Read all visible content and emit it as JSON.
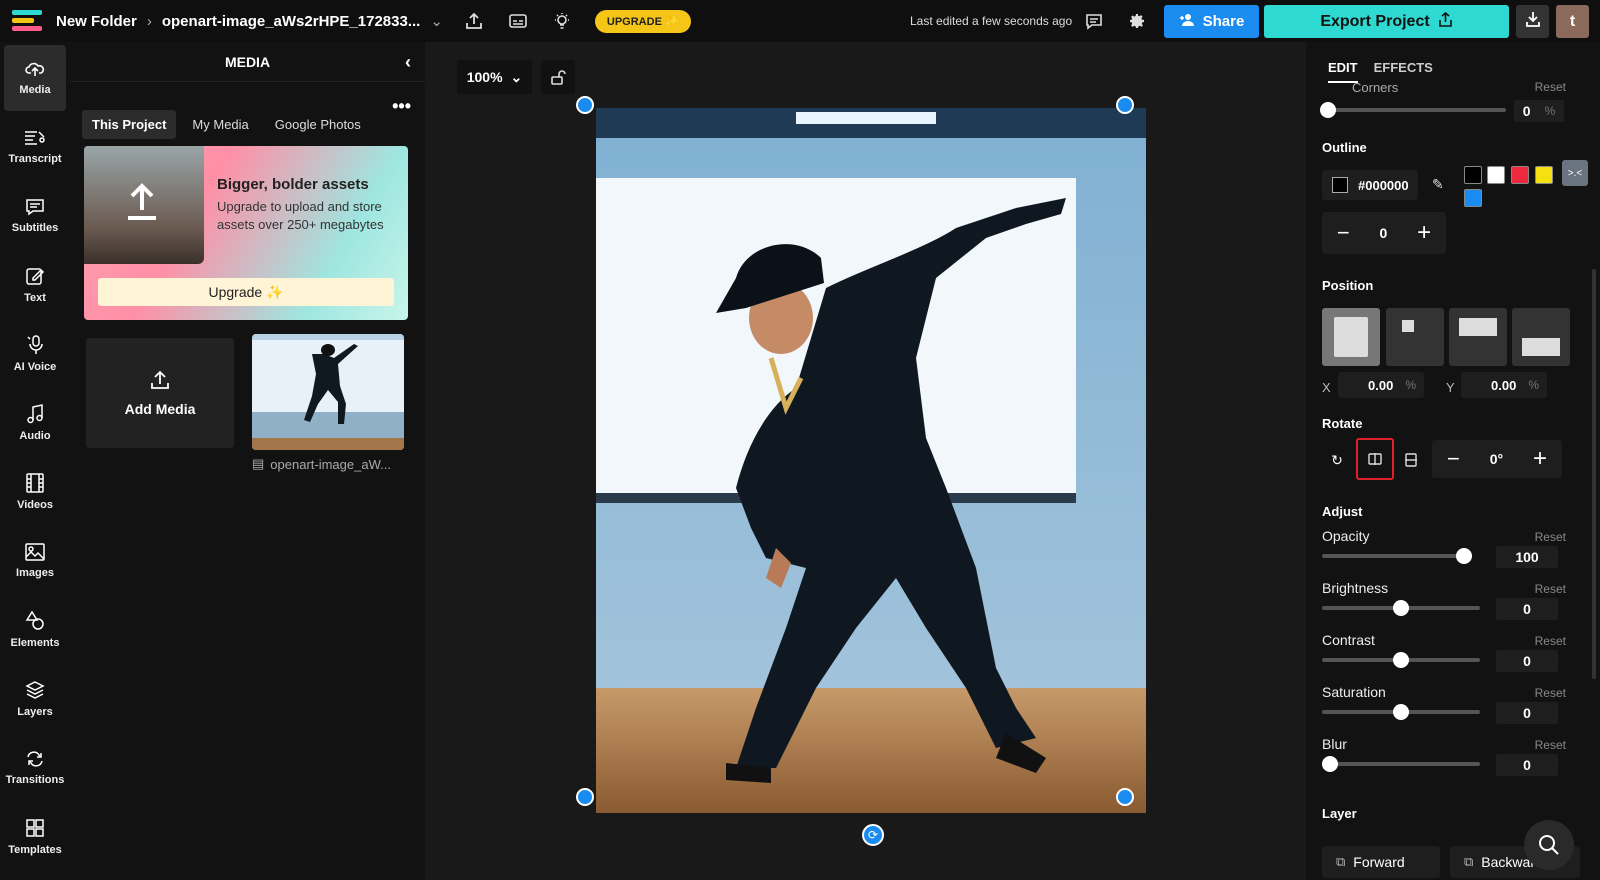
{
  "topbar": {
    "folder": "New Folder",
    "file": "openart-image_aWs2rHPE_172833...",
    "upgrade": "UPGRADE ✨",
    "last_edited": "Last edited a few seconds ago",
    "share": "Share",
    "export": "Export Project",
    "avatar_letter": "t"
  },
  "rail": [
    {
      "label": "Media",
      "icon": "upload-cloud-icon",
      "active": true
    },
    {
      "label": "Transcript",
      "icon": "transcript-icon"
    },
    {
      "label": "Subtitles",
      "icon": "subtitles-icon"
    },
    {
      "label": "Text",
      "icon": "text-edit-icon"
    },
    {
      "label": "AI Voice",
      "icon": "microphone-icon"
    },
    {
      "label": "Audio",
      "icon": "music-note-icon"
    },
    {
      "label": "Videos",
      "icon": "film-icon"
    },
    {
      "label": "Images",
      "icon": "image-icon"
    },
    {
      "label": "Elements",
      "icon": "shapes-icon"
    },
    {
      "label": "Layers",
      "icon": "layers-icon"
    },
    {
      "label": "Transitions",
      "icon": "transitions-icon"
    },
    {
      "label": "Templates",
      "icon": "templates-grid-icon"
    }
  ],
  "media": {
    "title": "MEDIA",
    "tabs": [
      "This Project",
      "My Media",
      "Google Photos"
    ],
    "promo_title": "Bigger, bolder assets",
    "promo_text": "Upgrade to upload and store assets over 250+ megabytes",
    "promo_button": "Upgrade ✨",
    "add_media": "Add Media",
    "thumb_name": "openart-image_aW..."
  },
  "canvas": {
    "zoom": "100%"
  },
  "panel": {
    "tabs": [
      "EDIT",
      "EFFECTS"
    ],
    "corners_label": "Corners",
    "reset": "Reset",
    "corners_value": "0",
    "percent": "%",
    "outline_title": "Outline",
    "outline_hex": "#000000",
    "outline_swatches": [
      "#000000",
      "#ffffff",
      "#f0283c",
      "#f5e010",
      "#1a8cf0"
    ],
    "outline_width": "0",
    "position_title": "Position",
    "x_label": "X",
    "y_label": "Y",
    "x_value": "0.00",
    "y_value": "0.00",
    "rotate_title": "Rotate",
    "rotate_value": "0°",
    "adjust_title": "Adjust",
    "adjust": [
      {
        "label": "Opacity",
        "value": "100",
        "fraction": 1.0
      },
      {
        "label": "Brightness",
        "value": "0",
        "fraction": 0.5
      },
      {
        "label": "Contrast",
        "value": "0",
        "fraction": 0.5
      },
      {
        "label": "Saturation",
        "value": "0",
        "fraction": 0.5
      },
      {
        "label": "Blur",
        "value": "0",
        "fraction": 0.0
      }
    ],
    "layer_title": "Layer",
    "forward": "Forward",
    "backward": "Backward"
  }
}
